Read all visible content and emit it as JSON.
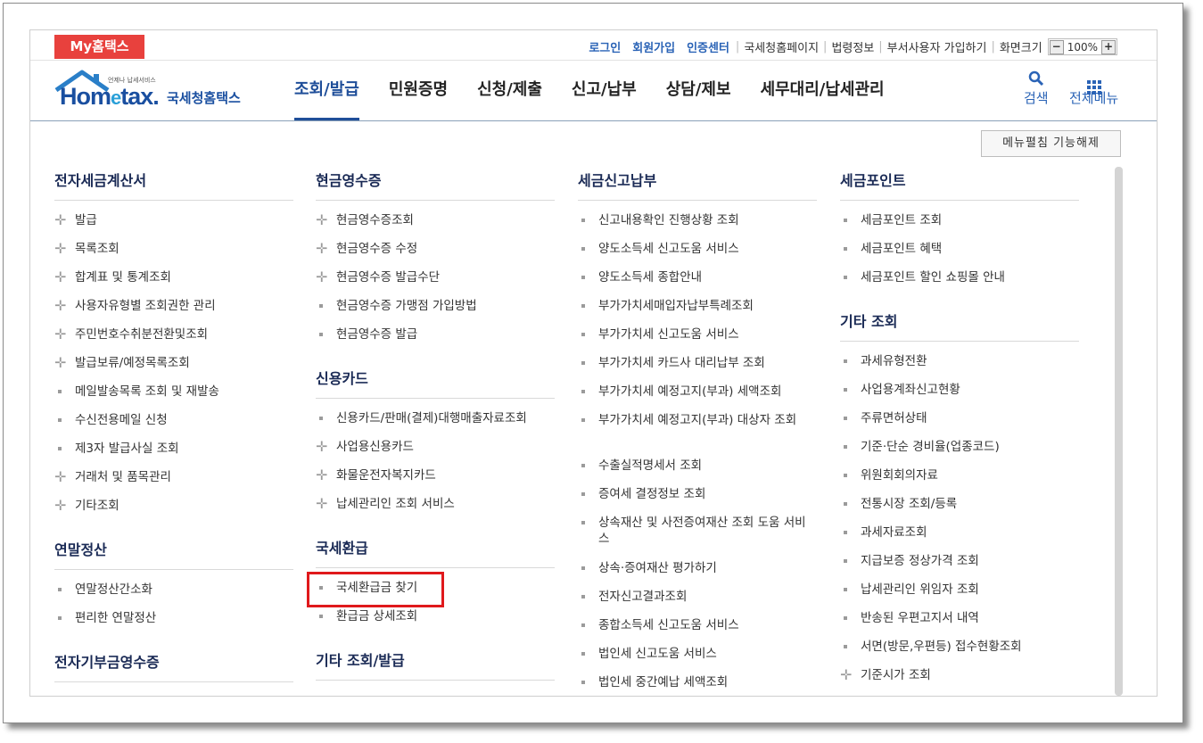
{
  "top": {
    "my_tab": "My홈택스",
    "links_blue": [
      "로그인",
      "회원가입",
      "인증센터"
    ],
    "links_plain": [
      "국세청홈페이지",
      "법령정보",
      "부서사용자 가입하기",
      "화면크기"
    ],
    "zoom": "100%"
  },
  "logo": {
    "tagline": "언제나 납세서비스",
    "main1": "Hom",
    "main_e": "e",
    "main2": "tax.",
    "kr": "국세청홈택스"
  },
  "nav": [
    "조회/발급",
    "민원증명",
    "신청/제출",
    "신고/납부",
    "상담/제보",
    "세무대리/납세관리"
  ],
  "header_icons": {
    "search": "검색",
    "menu": "전체메뉴"
  },
  "collapse_button": "메뉴펼침 기능해제",
  "columns": [
    {
      "sections": [
        {
          "title": "전자세금계산서",
          "items": [
            {
              "t": "발급",
              "m": "plus"
            },
            {
              "t": "목록조회",
              "m": "plus"
            },
            {
              "t": "합계표 및 통계조회",
              "m": "plus"
            },
            {
              "t": "사용자유형별 조회권한 관리",
              "m": "plus"
            },
            {
              "t": "주민번호수취분전환및조회",
              "m": "plus"
            },
            {
              "t": "발급보류/예정목록조회",
              "m": "plus"
            },
            {
              "t": "메일발송목록 조회 및 재발송",
              "m": "sq"
            },
            {
              "t": "수신전용메일 신청",
              "m": "sq"
            },
            {
              "t": "제3자 발급사실 조회",
              "m": "sq"
            },
            {
              "t": "거래처 및 품목관리",
              "m": "plus"
            },
            {
              "t": "기타조회",
              "m": "plus"
            }
          ]
        },
        {
          "title": "연말정산",
          "items": [
            {
              "t": "연말정산간소화",
              "m": "sq"
            },
            {
              "t": "편리한 연말정산",
              "m": "sq"
            }
          ]
        },
        {
          "title": "전자기부금영수증",
          "items": []
        }
      ]
    },
    {
      "sections": [
        {
          "title": "현금영수증",
          "items": [
            {
              "t": "현금영수증조회",
              "m": "plus"
            },
            {
              "t": "현금영수증 수정",
              "m": "plus"
            },
            {
              "t": "현금영수증 발급수단",
              "m": "plus"
            },
            {
              "t": "현금영수증 가맹점 가입방법",
              "m": "sq"
            },
            {
              "t": "현금영수증 발급",
              "m": "sq"
            }
          ]
        },
        {
          "title": "신용카드",
          "items": [
            {
              "t": "신용카드/판매(결제)대행매출자료조회",
              "m": "sq"
            },
            {
              "t": "사업용신용카드",
              "m": "plus"
            },
            {
              "t": "화물운전자복지카드",
              "m": "plus"
            },
            {
              "t": "납세관리인 조회 서비스",
              "m": "plus"
            }
          ]
        },
        {
          "title": "국세환급",
          "items": [
            {
              "t": "국세환급금 찾기",
              "m": "sq"
            },
            {
              "t": "환급금 상세조회",
              "m": "sq"
            }
          ]
        },
        {
          "title": "기타 조회/발급",
          "items": []
        }
      ]
    },
    {
      "sections": [
        {
          "title": "세금신고납부",
          "items": [
            {
              "t": "신고내용확인 진행상황 조회",
              "m": "sq"
            },
            {
              "t": "양도소득세 신고도움 서비스",
              "m": "sq"
            },
            {
              "t": "양도소득세 종합안내",
              "m": "sq"
            },
            {
              "t": "부가가치세매입자납부특례조회",
              "m": "sq"
            },
            {
              "t": "부가가치세 신고도움 서비스",
              "m": "sq"
            },
            {
              "t": "부가가치세 카드사 대리납부 조회",
              "m": "sq"
            },
            {
              "t": "부가가치세 예정고지(부과) 세액조회",
              "m": "sq"
            },
            {
              "t": "부가가치세 예정고지(부과) 대상자 조회",
              "m": "sq"
            },
            {
              "t": "수출실적명세서 조회",
              "m": "sq"
            },
            {
              "t": "증여세 결정정보 조회",
              "m": "sq"
            },
            {
              "t": "상속재산 및 사전증여재산 조회 도움 서비스",
              "m": "sq"
            },
            {
              "t": "상속·증여재산 평가하기",
              "m": "sq"
            },
            {
              "t": "전자신고결과조회",
              "m": "sq"
            },
            {
              "t": "종합소득세 신고도움 서비스",
              "m": "sq"
            },
            {
              "t": "법인세 신고도움 서비스",
              "m": "sq"
            },
            {
              "t": "법인세 중간예납 세액조회",
              "m": "sq"
            }
          ]
        }
      ]
    },
    {
      "sections": [
        {
          "title": "세금포인트",
          "items": [
            {
              "t": "세금포인트 조회",
              "m": "sq"
            },
            {
              "t": "세금포인트 혜택",
              "m": "sq"
            },
            {
              "t": "세금포인트 할인 쇼핑몰 안내",
              "m": "sq"
            }
          ]
        },
        {
          "title": "기타 조회",
          "items": [
            {
              "t": "과세유형전환",
              "m": "sq"
            },
            {
              "t": "사업용계좌신고현황",
              "m": "sq"
            },
            {
              "t": "주류면허상태",
              "m": "sq"
            },
            {
              "t": "기준·단순 경비율(업종코드)",
              "m": "sq"
            },
            {
              "t": "위원회회의자료",
              "m": "sq"
            },
            {
              "t": "전통시장 조회/등록",
              "m": "sq"
            },
            {
              "t": "과세자료조회",
              "m": "sq"
            },
            {
              "t": "지급보증 정상가격 조회",
              "m": "sq"
            },
            {
              "t": "납세관리인 위임자 조회",
              "m": "sq"
            },
            {
              "t": "반송된 우편고지서 내역",
              "m": "sq"
            },
            {
              "t": "서면(방문,우편등) 접수현황조회",
              "m": "sq"
            },
            {
              "t": "기준시가 조회",
              "m": "plus"
            }
          ]
        }
      ]
    }
  ]
}
